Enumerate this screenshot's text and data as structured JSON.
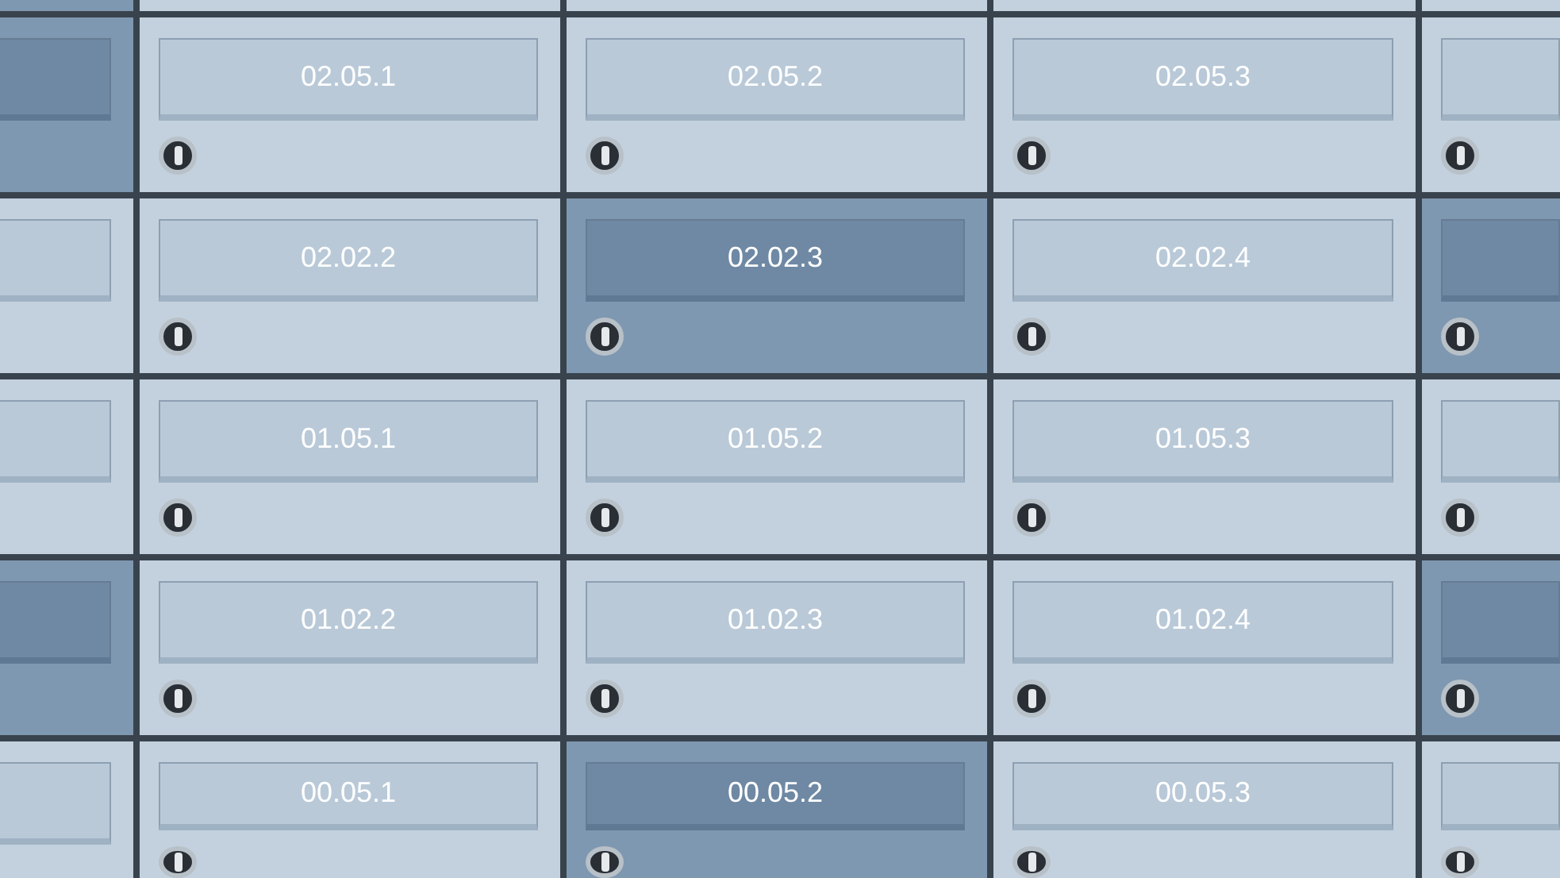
{
  "mailbox_rows": [
    {
      "boxes": [
        {
          "kind": "dark"
        },
        {
          "kind": "light"
        },
        {
          "kind": "light"
        },
        {
          "kind": "light"
        },
        {
          "kind": "light"
        }
      ]
    },
    {
      "boxes": [
        {
          "kind": "dark"
        },
        {
          "kind": "light",
          "label": "02.05.1"
        },
        {
          "kind": "light",
          "label": "02.05.2"
        },
        {
          "kind": "light",
          "label": "02.05.3"
        },
        {
          "kind": "light"
        }
      ]
    },
    {
      "boxes": [
        {
          "kind": "light"
        },
        {
          "kind": "light",
          "label": "02.02.2"
        },
        {
          "kind": "dark",
          "label": "02.02.3"
        },
        {
          "kind": "light",
          "label": "02.02.4"
        },
        {
          "kind": "dark"
        }
      ]
    },
    {
      "boxes": [
        {
          "kind": "light"
        },
        {
          "kind": "light",
          "label": "01.05.1"
        },
        {
          "kind": "light",
          "label": "01.05.2"
        },
        {
          "kind": "light",
          "label": "01.05.3"
        },
        {
          "kind": "light"
        }
      ]
    },
    {
      "boxes": [
        {
          "kind": "dark"
        },
        {
          "kind": "light",
          "label": "01.02.2"
        },
        {
          "kind": "light",
          "label": "01.02.3"
        },
        {
          "kind": "light",
          "label": "01.02.4"
        },
        {
          "kind": "dark"
        }
      ]
    },
    {
      "boxes": [
        {
          "kind": "light"
        },
        {
          "kind": "light",
          "label": "00.05.1"
        },
        {
          "kind": "dark",
          "label": "00.05.2"
        },
        {
          "kind": "light",
          "label": "00.05.3"
        },
        {
          "kind": "light"
        }
      ]
    }
  ]
}
